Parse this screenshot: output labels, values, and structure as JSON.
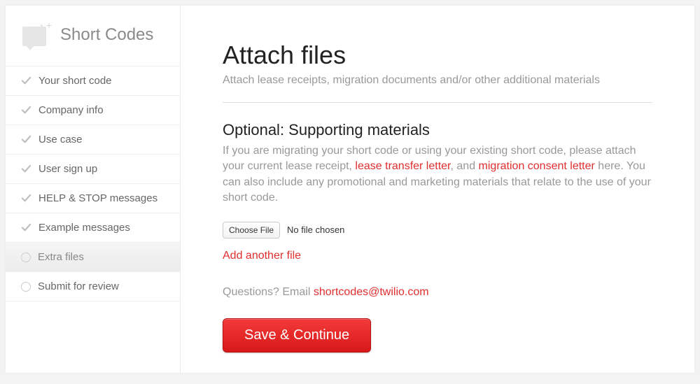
{
  "sidebar": {
    "title": "Short Codes",
    "items": [
      {
        "label": "Your short code",
        "status": "done"
      },
      {
        "label": "Company info",
        "status": "done"
      },
      {
        "label": "Use case",
        "status": "done"
      },
      {
        "label": "User sign up",
        "status": "done"
      },
      {
        "label": "HELP & STOP messages",
        "status": "done"
      },
      {
        "label": "Example messages",
        "status": "done"
      },
      {
        "label": "Extra files",
        "status": "current"
      },
      {
        "label": "Submit for review",
        "status": "pending"
      }
    ]
  },
  "main": {
    "title": "Attach files",
    "subtitle": "Attach lease receipts, migration documents and/or other additional materials",
    "section_title": "Optional: Supporting materials",
    "desc_part1": "If you are migrating your short code or using your existing short code, please attach your current lease receipt, ",
    "link1": "lease transfer letter",
    "desc_part2": ", and ",
    "link2": "migration consent letter",
    "desc_part3": " here. You can also include any promotional and marketing materials that relate to the use of your short code.",
    "choose_file_label": "Choose File",
    "no_file_text": "No file chosen",
    "add_another_label": "Add another file",
    "questions_prefix": "Questions? Email ",
    "questions_email": "shortcodes@twilio.com",
    "save_label": "Save & Continue"
  }
}
